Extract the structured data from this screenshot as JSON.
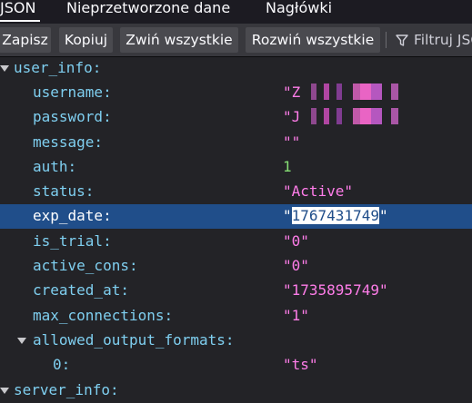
{
  "tabs": {
    "json": "JSON",
    "raw": "Nieprzetworzone dane",
    "headers": "Nagłówki"
  },
  "toolbar": {
    "save": "Zapisz",
    "copy": "Kopiuj",
    "collapse_all": "Zwiń wszystkie",
    "expand_all": "Rozwiń wszystkie",
    "filter_placeholder": "Filtruj JSON",
    "filter_icon": "funnel-icon"
  },
  "tree": {
    "user_info_key": "user_info:",
    "username_key": "username:",
    "username_prefix": "\"Z",
    "password_key": "password:",
    "password_prefix": "\"J",
    "message_key": "message:",
    "message_value": "\"\"",
    "auth_key": "auth:",
    "auth_value": "1",
    "status_key": "status:",
    "status_value": "\"Active\"",
    "exp_date_key": "exp_date:",
    "exp_date_value": "1767431749",
    "is_trial_key": "is_trial:",
    "is_trial_value": "\"0\"",
    "active_cons_key": "active_cons:",
    "active_cons_value": "\"0\"",
    "created_at_key": "created_at:",
    "created_at_value": "\"1735895749\"",
    "max_connections_key": "max_connections:",
    "max_connections_value": "\"1\"",
    "allowed_output_formats_key": "allowed_output_formats:",
    "format_0_key": "0:",
    "format_0_value": "\"ts\"",
    "server_info_key": "server_info:"
  },
  "colors": {
    "key": "#7fcff0",
    "string": "#ff7de9",
    "number": "#86de74",
    "selection": "#204e8a"
  }
}
